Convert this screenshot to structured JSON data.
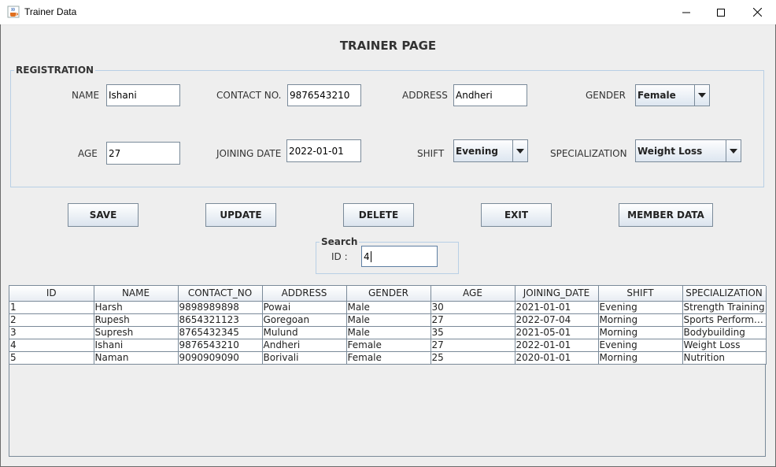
{
  "window": {
    "title": "Trainer Data"
  },
  "page": {
    "title": "TRAINER PAGE"
  },
  "registration": {
    "legend": "REGISTRATION",
    "name_label": "NAME",
    "name_value": "Ishani",
    "contact_label": "CONTACT NO.",
    "contact_value": "9876543210",
    "address_label": "ADDRESS",
    "address_value": "Andheri",
    "gender_label": "GENDER",
    "gender_value": "Female",
    "age_label": "AGE",
    "age_value": "27",
    "joining_label": "JOINING DATE",
    "joining_value": "2022-01-01",
    "shift_label": "SHIFT",
    "shift_value": "Evening",
    "specialization_label": "SPECIALIZATION",
    "specialization_value": "Weight Loss"
  },
  "buttons": {
    "save": "SAVE",
    "update": "UPDATE",
    "delete": "DELETE",
    "exit": "EXIT",
    "member_data": "MEMBER DATA"
  },
  "search": {
    "legend": "Search",
    "id_label": "ID :",
    "id_value": "4"
  },
  "table": {
    "columns": [
      "ID",
      "NAME",
      "CONTACT_NO",
      "ADDRESS",
      "GENDER",
      "AGE",
      "JOINING_DATE",
      "SHIFT",
      "SPECIALIZATION"
    ],
    "rows": [
      [
        "1",
        "Harsh",
        "9898989898",
        "Powai",
        "Male",
        "30",
        "2021-01-01",
        "Evening",
        "Strength Training"
      ],
      [
        "2",
        "Rupesh",
        "8654321123",
        "Goregoan",
        "Male",
        "27",
        "2022-07-04",
        "Morning",
        "Sports Performa..."
      ],
      [
        "3",
        "Supresh",
        "8765432345",
        "Mulund",
        "Male",
        "35",
        "2021-05-01",
        "Morning",
        "Bodybuilding"
      ],
      [
        "4",
        "Ishani",
        "9876543210",
        "Andheri",
        "Female",
        "27",
        "2022-01-01",
        "Evening",
        "Weight Loss"
      ],
      [
        "5",
        "Naman",
        "9090909090",
        "Borivali",
        "Female",
        "25",
        "2020-01-01",
        "Morning",
        "Nutrition"
      ]
    ]
  },
  "icons": {
    "app": "java-cup-icon",
    "minimize": "minimize-icon",
    "maximize": "maximize-icon",
    "close": "close-icon",
    "dropdown": "chevron-down-icon"
  }
}
